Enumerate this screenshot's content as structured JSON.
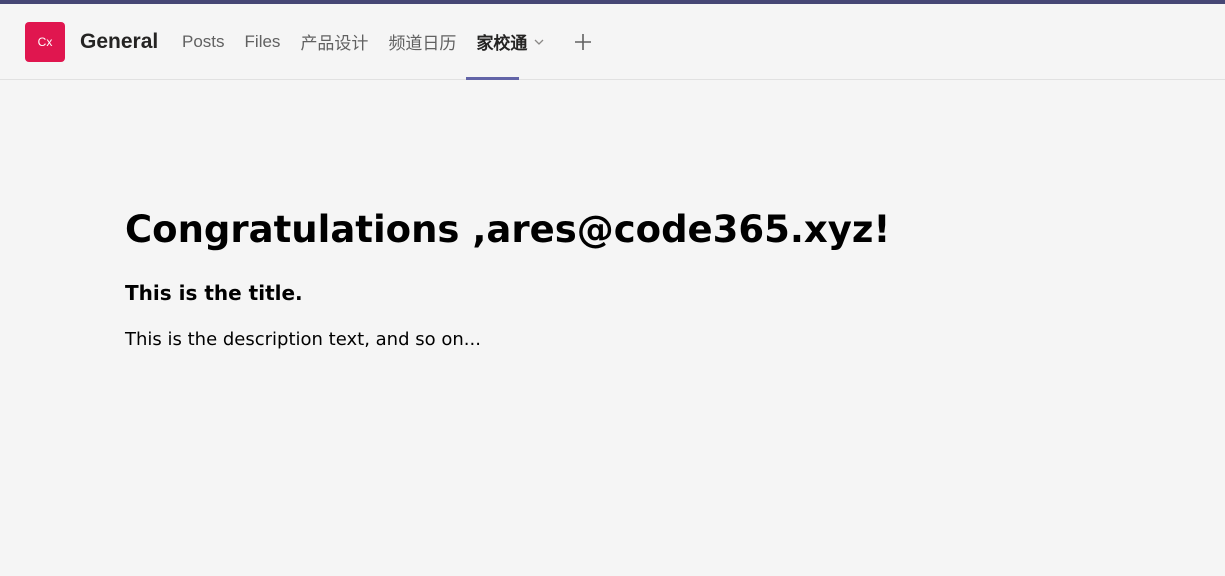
{
  "header": {
    "avatar_initials": "Cx",
    "avatar_color": "#e0164f",
    "team_name": "General",
    "tabs": [
      {
        "label": "Posts"
      },
      {
        "label": "Files"
      },
      {
        "label": "产品设计"
      },
      {
        "label": "频道日历"
      },
      {
        "label": "家校通",
        "active": true
      }
    ],
    "accent_color": "#6264a7",
    "add_icon": "plus-icon",
    "dropdown_icon": "chevron-down-icon"
  },
  "main": {
    "heading": "Congratulations ,ares@code365.xyz!",
    "title": "This is the title.",
    "description": "This is the description text, and so on..."
  }
}
